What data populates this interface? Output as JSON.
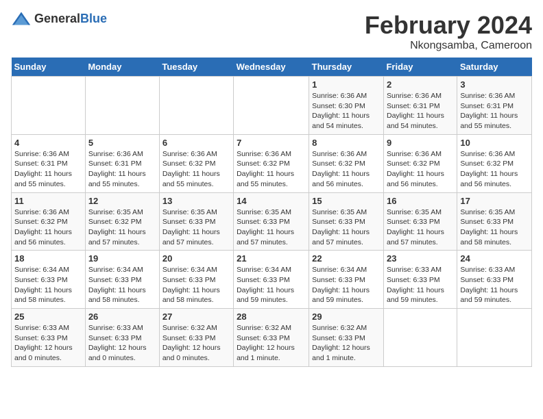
{
  "header": {
    "logo_general": "General",
    "logo_blue": "Blue",
    "title": "February 2024",
    "subtitle": "Nkongsamba, Cameroon"
  },
  "days_of_week": [
    "Sunday",
    "Monday",
    "Tuesday",
    "Wednesday",
    "Thursday",
    "Friday",
    "Saturday"
  ],
  "weeks": [
    [
      {
        "day": "",
        "info": ""
      },
      {
        "day": "",
        "info": ""
      },
      {
        "day": "",
        "info": ""
      },
      {
        "day": "",
        "info": ""
      },
      {
        "day": "1",
        "info": "Sunrise: 6:36 AM\nSunset: 6:30 PM\nDaylight: 11 hours and 54 minutes."
      },
      {
        "day": "2",
        "info": "Sunrise: 6:36 AM\nSunset: 6:31 PM\nDaylight: 11 hours and 54 minutes."
      },
      {
        "day": "3",
        "info": "Sunrise: 6:36 AM\nSunset: 6:31 PM\nDaylight: 11 hours and 55 minutes."
      }
    ],
    [
      {
        "day": "4",
        "info": "Sunrise: 6:36 AM\nSunset: 6:31 PM\nDaylight: 11 hours and 55 minutes."
      },
      {
        "day": "5",
        "info": "Sunrise: 6:36 AM\nSunset: 6:31 PM\nDaylight: 11 hours and 55 minutes."
      },
      {
        "day": "6",
        "info": "Sunrise: 6:36 AM\nSunset: 6:32 PM\nDaylight: 11 hours and 55 minutes."
      },
      {
        "day": "7",
        "info": "Sunrise: 6:36 AM\nSunset: 6:32 PM\nDaylight: 11 hours and 55 minutes."
      },
      {
        "day": "8",
        "info": "Sunrise: 6:36 AM\nSunset: 6:32 PM\nDaylight: 11 hours and 56 minutes."
      },
      {
        "day": "9",
        "info": "Sunrise: 6:36 AM\nSunset: 6:32 PM\nDaylight: 11 hours and 56 minutes."
      },
      {
        "day": "10",
        "info": "Sunrise: 6:36 AM\nSunset: 6:32 PM\nDaylight: 11 hours and 56 minutes."
      }
    ],
    [
      {
        "day": "11",
        "info": "Sunrise: 6:36 AM\nSunset: 6:32 PM\nDaylight: 11 hours and 56 minutes."
      },
      {
        "day": "12",
        "info": "Sunrise: 6:35 AM\nSunset: 6:32 PM\nDaylight: 11 hours and 57 minutes."
      },
      {
        "day": "13",
        "info": "Sunrise: 6:35 AM\nSunset: 6:33 PM\nDaylight: 11 hours and 57 minutes."
      },
      {
        "day": "14",
        "info": "Sunrise: 6:35 AM\nSunset: 6:33 PM\nDaylight: 11 hours and 57 minutes."
      },
      {
        "day": "15",
        "info": "Sunrise: 6:35 AM\nSunset: 6:33 PM\nDaylight: 11 hours and 57 minutes."
      },
      {
        "day": "16",
        "info": "Sunrise: 6:35 AM\nSunset: 6:33 PM\nDaylight: 11 hours and 57 minutes."
      },
      {
        "day": "17",
        "info": "Sunrise: 6:35 AM\nSunset: 6:33 PM\nDaylight: 11 hours and 58 minutes."
      }
    ],
    [
      {
        "day": "18",
        "info": "Sunrise: 6:34 AM\nSunset: 6:33 PM\nDaylight: 11 hours and 58 minutes."
      },
      {
        "day": "19",
        "info": "Sunrise: 6:34 AM\nSunset: 6:33 PM\nDaylight: 11 hours and 58 minutes."
      },
      {
        "day": "20",
        "info": "Sunrise: 6:34 AM\nSunset: 6:33 PM\nDaylight: 11 hours and 58 minutes."
      },
      {
        "day": "21",
        "info": "Sunrise: 6:34 AM\nSunset: 6:33 PM\nDaylight: 11 hours and 59 minutes."
      },
      {
        "day": "22",
        "info": "Sunrise: 6:34 AM\nSunset: 6:33 PM\nDaylight: 11 hours and 59 minutes."
      },
      {
        "day": "23",
        "info": "Sunrise: 6:33 AM\nSunset: 6:33 PM\nDaylight: 11 hours and 59 minutes."
      },
      {
        "day": "24",
        "info": "Sunrise: 6:33 AM\nSunset: 6:33 PM\nDaylight: 11 hours and 59 minutes."
      }
    ],
    [
      {
        "day": "25",
        "info": "Sunrise: 6:33 AM\nSunset: 6:33 PM\nDaylight: 12 hours and 0 minutes."
      },
      {
        "day": "26",
        "info": "Sunrise: 6:33 AM\nSunset: 6:33 PM\nDaylight: 12 hours and 0 minutes."
      },
      {
        "day": "27",
        "info": "Sunrise: 6:32 AM\nSunset: 6:33 PM\nDaylight: 12 hours and 0 minutes."
      },
      {
        "day": "28",
        "info": "Sunrise: 6:32 AM\nSunset: 6:33 PM\nDaylight: 12 hours and 1 minute."
      },
      {
        "day": "29",
        "info": "Sunrise: 6:32 AM\nSunset: 6:33 PM\nDaylight: 12 hours and 1 minute."
      },
      {
        "day": "",
        "info": ""
      },
      {
        "day": "",
        "info": ""
      }
    ]
  ]
}
